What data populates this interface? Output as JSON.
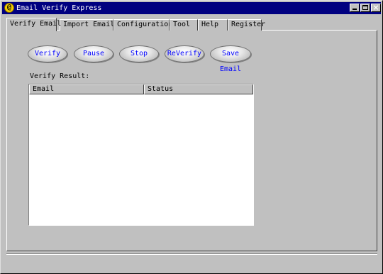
{
  "window": {
    "title": "Email Verify Express",
    "icon": "email-at-icon",
    "controls": {
      "minimize": "minimize-icon",
      "maximize": "maximize-icon",
      "close": "close-icon"
    }
  },
  "tabs": [
    {
      "label": "Verify Email",
      "active": true
    },
    {
      "label": "Import Email",
      "active": false
    },
    {
      "label": "Configuration",
      "active": false
    },
    {
      "label": "Tool",
      "active": false
    },
    {
      "label": "Help",
      "active": false
    },
    {
      "label": "Register",
      "active": false
    }
  ],
  "actions": {
    "verify": "Verify",
    "pause": "Pause",
    "stop": "Stop",
    "reverify": "ReVerify",
    "save_email": "Save Email"
  },
  "result": {
    "label": "Verify Result:",
    "columns": [
      "Email",
      "Status"
    ],
    "rows": []
  },
  "colors": {
    "window_bg": "#c0c0c0",
    "titlebar": "#000080",
    "button_text": "#0000ff",
    "list_bg": "#ffffff"
  }
}
